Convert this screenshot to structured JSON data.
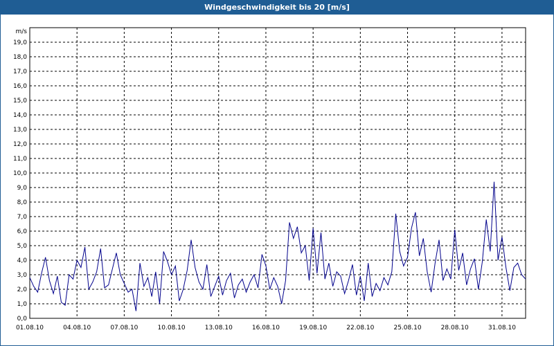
{
  "window": {
    "title": "Windgeschwindigkeit bis 20 [m/s]"
  },
  "colors": {
    "title_bar": "#1f5d94",
    "series": "#00008b",
    "grid": "#000000"
  },
  "chart_data": {
    "type": "line",
    "title": "Windgeschwindigkeit bis 20 [m/s]",
    "ylabel": "m/s",
    "xlabel": "",
    "ylim": [
      0,
      20
    ],
    "y_ticks": [
      "0,0",
      "1,0",
      "2,0",
      "3,0",
      "4,0",
      "5,0",
      "6,0",
      "7,0",
      "8,0",
      "9,0",
      "10,0",
      "11,0",
      "12,0",
      "13,0",
      "14,0",
      "15,0",
      "16,0",
      "17,0",
      "18,0",
      "19,0"
    ],
    "x_ticks": [
      "01.08.10",
      "04.08.10",
      "07.08.10",
      "10.08.10",
      "13.08.10",
      "16.08.10",
      "19.08.10",
      "22.08.10",
      "25.08.10",
      "28.08.10",
      "31.08.10"
    ],
    "x_range": [
      "2010-08-01 00:00",
      "2010-09-01 12:00"
    ],
    "grid": true,
    "series": [
      {
        "values": [
          [
            "2010-08-01 00:00",
            2.8
          ],
          [
            "2010-08-01 06:00",
            2.2
          ],
          [
            "2010-08-01 12:00",
            1.8
          ],
          [
            "2010-08-01 18:00",
            3.1
          ],
          [
            "2010-08-02 00:00",
            4.2
          ],
          [
            "2010-08-02 06:00",
            2.6
          ],
          [
            "2010-08-02 12:00",
            1.7
          ],
          [
            "2010-08-02 18:00",
            2.9
          ],
          [
            "2010-08-03 00:00",
            1.1
          ],
          [
            "2010-08-03 06:00",
            0.9
          ],
          [
            "2010-08-03 12:00",
            3.0
          ],
          [
            "2010-08-03 18:00",
            2.7
          ],
          [
            "2010-08-04 00:00",
            4.0
          ],
          [
            "2010-08-04 06:00",
            3.5
          ],
          [
            "2010-08-04 12:00",
            4.9
          ],
          [
            "2010-08-04 18:00",
            2.0
          ],
          [
            "2010-08-05 00:00",
            2.5
          ],
          [
            "2010-08-05 06:00",
            3.2
          ],
          [
            "2010-08-05 12:00",
            4.8
          ],
          [
            "2010-08-05 18:00",
            2.1
          ],
          [
            "2010-08-06 00:00",
            2.3
          ],
          [
            "2010-08-06 06:00",
            3.4
          ],
          [
            "2010-08-06 12:00",
            4.5
          ],
          [
            "2010-08-06 18:00",
            3.0
          ],
          [
            "2010-08-07 00:00",
            2.4
          ],
          [
            "2010-08-07 06:00",
            1.8
          ],
          [
            "2010-08-07 12:00",
            2.0
          ],
          [
            "2010-08-07 18:00",
            0.5
          ],
          [
            "2010-08-08 00:00",
            3.8
          ],
          [
            "2010-08-08 06:00",
            2.2
          ],
          [
            "2010-08-08 12:00",
            2.8
          ],
          [
            "2010-08-08 18:00",
            1.5
          ],
          [
            "2010-08-09 00:00",
            3.2
          ],
          [
            "2010-08-09 06:00",
            1.0
          ],
          [
            "2010-08-09 12:00",
            4.6
          ],
          [
            "2010-08-09 18:00",
            3.9
          ],
          [
            "2010-08-10 00:00",
            3.0
          ],
          [
            "2010-08-10 06:00",
            3.6
          ],
          [
            "2010-08-10 12:00",
            1.2
          ],
          [
            "2010-08-10 18:00",
            2.0
          ],
          [
            "2010-08-11 00:00",
            3.3
          ],
          [
            "2010-08-11 06:00",
            5.4
          ],
          [
            "2010-08-11 12:00",
            3.5
          ],
          [
            "2010-08-11 18:00",
            2.5
          ],
          [
            "2010-08-12 00:00",
            2.0
          ],
          [
            "2010-08-12 06:00",
            3.7
          ],
          [
            "2010-08-12 12:00",
            1.5
          ],
          [
            "2010-08-12 18:00",
            2.2
          ],
          [
            "2010-08-13 00:00",
            2.9
          ],
          [
            "2010-08-13 06:00",
            1.6
          ],
          [
            "2010-08-13 12:00",
            2.6
          ],
          [
            "2010-08-13 18:00",
            3.1
          ],
          [
            "2010-08-14 00:00",
            1.4
          ],
          [
            "2010-08-14 06:00",
            2.3
          ],
          [
            "2010-08-14 12:00",
            2.7
          ],
          [
            "2010-08-14 18:00",
            1.8
          ],
          [
            "2010-08-15 00:00",
            2.5
          ],
          [
            "2010-08-15 06:00",
            3.0
          ],
          [
            "2010-08-15 12:00",
            2.1
          ],
          [
            "2010-08-15 18:00",
            4.4
          ],
          [
            "2010-08-16 00:00",
            3.6
          ],
          [
            "2010-08-16 06:00",
            2.0
          ],
          [
            "2010-08-16 12:00",
            2.8
          ],
          [
            "2010-08-16 18:00",
            2.2
          ],
          [
            "2010-08-17 00:00",
            1.0
          ],
          [
            "2010-08-17 06:00",
            2.6
          ],
          [
            "2010-08-17 12:00",
            6.6
          ],
          [
            "2010-08-17 18:00",
            5.5
          ],
          [
            "2010-08-18 00:00",
            6.3
          ],
          [
            "2010-08-18 06:00",
            4.5
          ],
          [
            "2010-08-18 12:00",
            5.0
          ],
          [
            "2010-08-18 18:00",
            2.6
          ],
          [
            "2010-08-19 00:00",
            6.2
          ],
          [
            "2010-08-19 06:00",
            3.1
          ],
          [
            "2010-08-19 12:00",
            5.9
          ],
          [
            "2010-08-19 18:00",
            2.7
          ],
          [
            "2010-08-20 00:00",
            3.8
          ],
          [
            "2010-08-20 06:00",
            2.2
          ],
          [
            "2010-08-20 12:00",
            3.2
          ],
          [
            "2010-08-20 18:00",
            2.9
          ],
          [
            "2010-08-21 00:00",
            1.7
          ],
          [
            "2010-08-21 06:00",
            2.6
          ],
          [
            "2010-08-21 12:00",
            3.7
          ],
          [
            "2010-08-21 18:00",
            1.6
          ],
          [
            "2010-08-22 00:00",
            2.9
          ],
          [
            "2010-08-22 06:00",
            1.2
          ],
          [
            "2010-08-22 12:00",
            3.8
          ],
          [
            "2010-08-22 18:00",
            1.5
          ],
          [
            "2010-08-23 00:00",
            2.4
          ],
          [
            "2010-08-23 06:00",
            1.9
          ],
          [
            "2010-08-23 12:00",
            2.8
          ],
          [
            "2010-08-23 18:00",
            2.3
          ],
          [
            "2010-08-24 00:00",
            3.2
          ],
          [
            "2010-08-24 06:00",
            7.2
          ],
          [
            "2010-08-24 12:00",
            4.6
          ],
          [
            "2010-08-24 18:00",
            3.6
          ],
          [
            "2010-08-25 00:00",
            4.2
          ],
          [
            "2010-08-25 06:00",
            6.2
          ],
          [
            "2010-08-25 12:00",
            7.3
          ],
          [
            "2010-08-25 18:00",
            4.3
          ],
          [
            "2010-08-26 00:00",
            5.5
          ],
          [
            "2010-08-26 06:00",
            3.2
          ],
          [
            "2010-08-26 12:00",
            1.8
          ],
          [
            "2010-08-26 18:00",
            3.8
          ],
          [
            "2010-08-27 00:00",
            5.4
          ],
          [
            "2010-08-27 06:00",
            2.6
          ],
          [
            "2010-08-27 12:00",
            3.4
          ],
          [
            "2010-08-27 18:00",
            2.7
          ],
          [
            "2010-08-28 00:00",
            6.1
          ],
          [
            "2010-08-28 06:00",
            3.3
          ],
          [
            "2010-08-28 12:00",
            4.5
          ],
          [
            "2010-08-28 18:00",
            2.3
          ],
          [
            "2010-08-29 00:00",
            3.4
          ],
          [
            "2010-08-29 06:00",
            4.1
          ],
          [
            "2010-08-29 12:00",
            2.0
          ],
          [
            "2010-08-29 18:00",
            3.9
          ],
          [
            "2010-08-30 00:00",
            6.8
          ],
          [
            "2010-08-30 06:00",
            4.6
          ],
          [
            "2010-08-30 12:00",
            9.4
          ],
          [
            "2010-08-30 18:00",
            4.0
          ],
          [
            "2010-08-31 00:00",
            5.6
          ],
          [
            "2010-08-31 06:00",
            3.5
          ],
          [
            "2010-08-31 12:00",
            1.9
          ],
          [
            "2010-08-31 18:00",
            3.5
          ],
          [
            "2010-09-01 00:00",
            3.8
          ],
          [
            "2010-09-01 06:00",
            3.0
          ],
          [
            "2010-09-01 12:00",
            2.7
          ]
        ]
      }
    ]
  }
}
